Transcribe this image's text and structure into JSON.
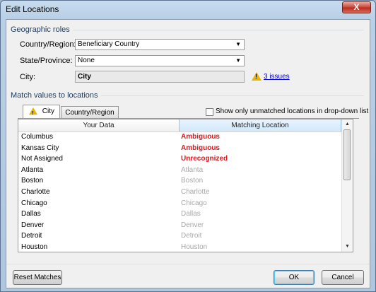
{
  "window": {
    "title": "Edit Locations",
    "close_label": "X"
  },
  "geographic_roles": {
    "group_label": "Geographic roles",
    "country_label": "Country/Region:",
    "country_value": "Beneficiary Country",
    "state_label": "State/Province:",
    "state_value": "None",
    "city_label": "City:",
    "city_value": "City",
    "issues_link": "3 issues"
  },
  "match": {
    "group_label": "Match values to locations",
    "tabs": [
      {
        "label": "City"
      },
      {
        "label": "Country/Region"
      }
    ],
    "show_unmatched_label": "Show only unmatched locations in drop-down list",
    "columns": {
      "your_data": "Your Data",
      "matching_location": "Matching Location"
    },
    "rows": [
      {
        "data": "Columbus",
        "match": "Ambiguous",
        "status": "error"
      },
      {
        "data": "Kansas City",
        "match": "Ambiguous",
        "status": "error"
      },
      {
        "data": "Not Assigned",
        "match": "Unrecognized",
        "status": "error"
      },
      {
        "data": "Atlanta",
        "match": "Atlanta",
        "status": "ok"
      },
      {
        "data": "Boston",
        "match": "Boston",
        "status": "ok"
      },
      {
        "data": "Charlotte",
        "match": "Charlotte",
        "status": "ok"
      },
      {
        "data": "Chicago",
        "match": "Chicago",
        "status": "ok"
      },
      {
        "data": "Dallas",
        "match": "Dallas",
        "status": "ok"
      },
      {
        "data": "Denver",
        "match": "Denver",
        "status": "ok"
      },
      {
        "data": "Detroit",
        "match": "Detroit",
        "status": "ok"
      },
      {
        "data": "Houston",
        "match": "Houston",
        "status": "ok"
      }
    ]
  },
  "buttons": {
    "reset": "Reset Matches",
    "ok": "OK",
    "cancel": "Cancel"
  },
  "colors": {
    "error_text": "#e0191f",
    "ok_text": "#a8a8a8",
    "link": "#0000cc"
  }
}
